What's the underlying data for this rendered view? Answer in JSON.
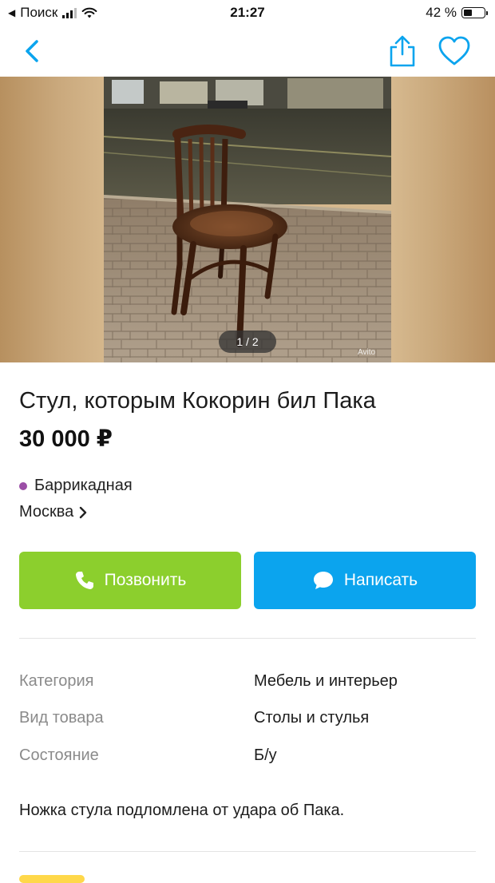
{
  "status_bar": {
    "back_app": "Поиск",
    "time": "21:27",
    "battery": "42 %",
    "battery_level": 0.42
  },
  "nav": {
    "back_icon": "chevron-left-icon",
    "share_icon": "share-icon",
    "favorite_icon": "heart-icon",
    "accent_color": "#0ba4ee"
  },
  "gallery": {
    "counter": "1 / 2",
    "watermark": "Avito"
  },
  "listing": {
    "title": "Стул, которым Кокорин бил Пака",
    "price": "30 000 ₽",
    "metro": "Баррикадная",
    "metro_color": "#9b4ea6",
    "city": "Москва"
  },
  "actions": {
    "call_label": "Позвонить",
    "call_color": "#8ccf2d",
    "write_label": "Написать",
    "write_color": "#0ba4ee"
  },
  "params": [
    {
      "key": "Категория",
      "value": "Мебель и интерьер"
    },
    {
      "key": "Вид товара",
      "value": "Столы и стулья"
    },
    {
      "key": "Состояние",
      "value": "Б/у"
    }
  ],
  "description": "Ножка стула подломлена от удара об Пака."
}
